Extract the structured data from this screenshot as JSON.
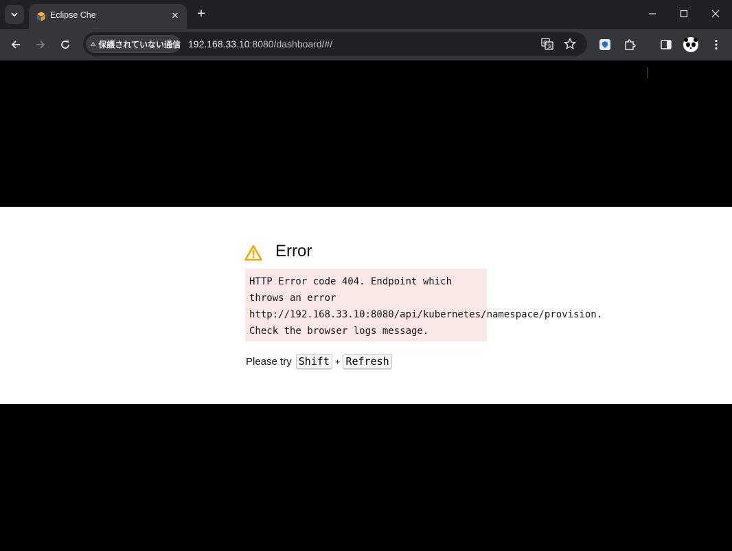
{
  "browser": {
    "tab": {
      "title": "Eclipse Che",
      "close_glyph": "✕"
    },
    "new_tab_glyph": "+",
    "security_chip": "保護されていない通信",
    "url": {
      "host": "192.168.33.10",
      "rest": ":8080/dashboard/#/"
    },
    "icons": [
      "tab-search-icon",
      "back-icon",
      "forward-icon",
      "reload-icon",
      "warning-icon",
      "translate-icon",
      "star-icon",
      "extension-puzzle-icon",
      "side-panel-icon",
      "profile-avatar-icon",
      "menu-kebab-icon",
      "minimize-icon",
      "maximize-icon",
      "close-window-icon"
    ]
  },
  "page": {
    "error_title": "Error",
    "error_message_lines": [
      "HTTP Error code 404. Endpoint which",
      "throws an error",
      "http://192.168.33.10:8080/api/kubernetes/namespace/provision.",
      "Check the browser logs message."
    ],
    "hint_prefix": "Please try",
    "hint_key1": "Shift",
    "hint_plus": "+",
    "hint_key2": "Refresh",
    "colors": {
      "warning": "#f0ab00",
      "error_bg": "#fae8e7"
    }
  }
}
